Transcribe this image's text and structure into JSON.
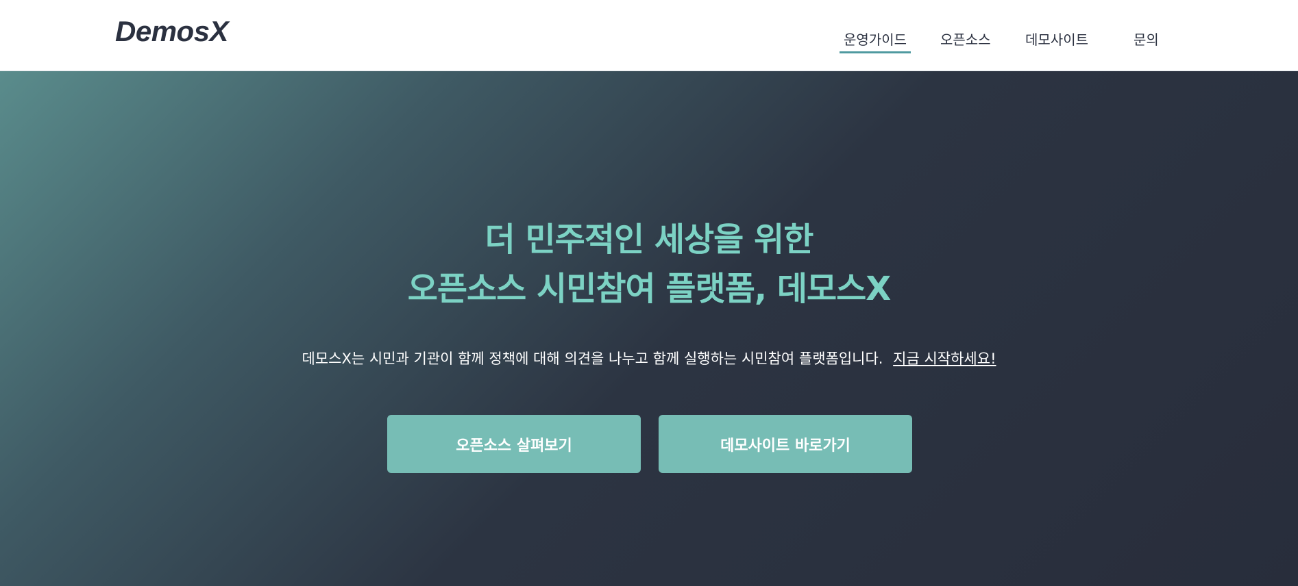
{
  "header": {
    "logo": "DemosX",
    "nav": [
      {
        "label": "운영가이드",
        "active": true
      },
      {
        "label": "오픈소스",
        "active": false
      },
      {
        "label": "데모사이트",
        "active": false
      },
      {
        "label": "문의",
        "active": false
      }
    ],
    "accent_color": "#4f9aa0"
  },
  "hero": {
    "headline_line1": "더 민주적인 세상을 위한",
    "headline_line2": "오픈소스 시민참여 플랫폼, 데모스X",
    "description": "데모스X는 시민과 기관이 함께 정책에 대해 의견을 나누고 함께 실행하는 시민참여 플랫폼입니다.",
    "start_link": "지금 시작하세요!",
    "buttons": {
      "opensource": "오픈소스 살펴보기",
      "demosite": "데모사이트 바로가기"
    },
    "headline_color": "#7cd2c4",
    "button_color": "#77bdb5"
  }
}
